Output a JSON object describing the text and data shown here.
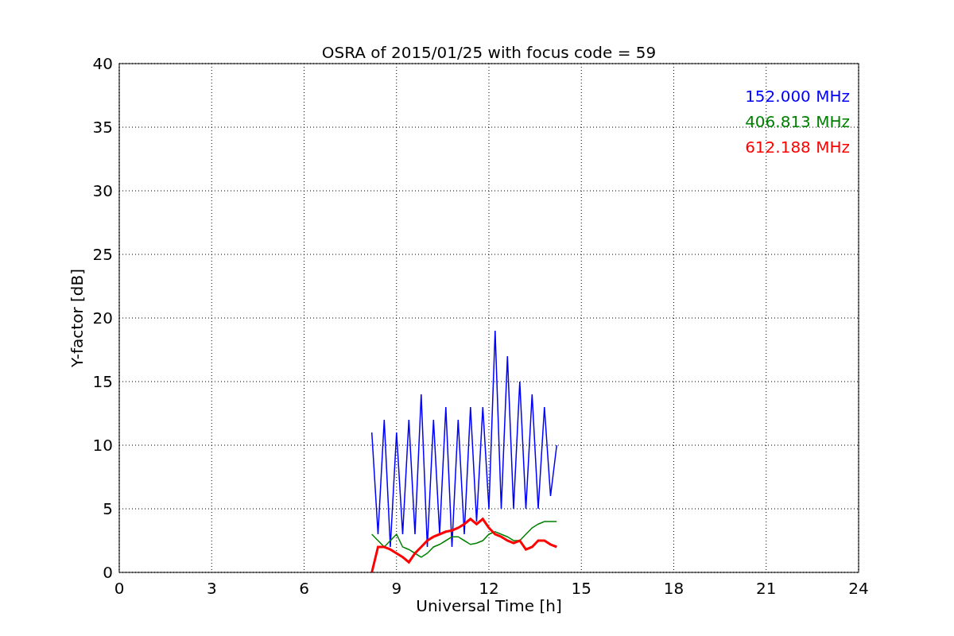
{
  "chart_data": {
    "type": "line",
    "title": "OSRA of 2015/01/25 with focus code = 59",
    "xlabel": "Universal Time [h]",
    "ylabel": "Y-factor [dB]",
    "x": [
      8.2,
      8.4,
      8.6,
      8.8,
      9.0,
      9.2,
      9.4,
      9.6,
      9.8,
      10.0,
      10.2,
      10.4,
      10.6,
      10.8,
      11.0,
      11.2,
      11.4,
      11.6,
      11.8,
      12.0,
      12.2,
      12.4,
      12.6,
      12.8,
      13.0,
      13.2,
      13.4,
      13.6,
      13.8,
      14.0,
      14.2
    ],
    "series": [
      {
        "name": "152.000 MHz",
        "color": "#0000ff",
        "values": [
          11,
          3,
          12,
          2,
          11,
          3,
          12,
          3,
          14,
          2,
          12,
          3,
          13,
          2,
          12,
          3,
          13,
          4,
          13,
          5,
          19,
          5,
          17,
          5,
          15,
          5,
          14,
          5,
          13,
          6,
          10
        ]
      },
      {
        "name": "406.813 MHz",
        "color": "#008000",
        "values": [
          3,
          2.5,
          2,
          2.5,
          3,
          2,
          1.8,
          1.5,
          1.2,
          1.5,
          2,
          2.2,
          2.5,
          2.8,
          2.8,
          2.5,
          2.2,
          2.3,
          2.5,
          3,
          3.2,
          3,
          2.8,
          2.5,
          2.5,
          3,
          3.5,
          3.8,
          4,
          4,
          4
        ]
      },
      {
        "name": "612.188 MHz",
        "color": "#ff0000",
        "values": [
          0,
          2,
          2,
          1.8,
          1.5,
          1.2,
          0.8,
          1.5,
          2,
          2.5,
          2.8,
          3,
          3.2,
          3.3,
          3.5,
          3.8,
          4.2,
          3.8,
          4.2,
          3.5,
          3,
          2.8,
          2.5,
          2.3,
          2.5,
          1.8,
          2,
          2.5,
          2.5,
          2.2,
          2
        ]
      }
    ],
    "grid": true,
    "xlim": [
      0,
      24
    ],
    "ylim": [
      0,
      40
    ],
    "xticks": [
      0,
      3,
      6,
      9,
      12,
      15,
      18,
      21,
      24
    ],
    "yticks": [
      0,
      5,
      10,
      15,
      20,
      25,
      30,
      35,
      40
    ]
  }
}
